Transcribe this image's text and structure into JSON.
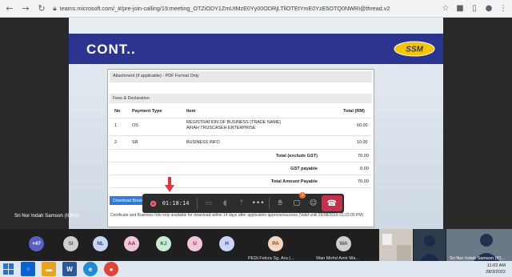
{
  "browser": {
    "back_icon": "back-arrow-icon",
    "forward_icon": "forward-arrow-icon",
    "reload_icon": "reload-icon",
    "url": "teams.microsoft.com/_#/pre-join-calling/19:meeting_OTZiODY1ZmUtMzE0Yy00ODRjLTllOTEtYmE0YzE5OTQ0NWRI@thread.v2"
  },
  "slide": {
    "title": "CONT..",
    "logo_text": "SSM"
  },
  "document": {
    "attachment_header": "Attachment (if applicable) - PDF Format Only",
    "fees_header": "Fees & Declaration",
    "columns": [
      "No",
      "Payment Type",
      "Item",
      "Total (RM)"
    ],
    "rows": [
      {
        "no": "1",
        "type": "OS",
        "item_line1": "REGISTRATION OF BUSINESS (TRADE NAME)",
        "item_line2": "AFIAH TRUSCASEH ENTERPRISE",
        "total": "60.00"
      },
      {
        "no": "2",
        "type": "SR",
        "item_line1": "BUSINESS INFO",
        "item_line2": "",
        "total": "10.00"
      }
    ],
    "total_exclude_gst_label": "Total (exclude GST)",
    "total_exclude_gst_value": "70.00",
    "gst_label": "GST payable",
    "gst_value": "0.00",
    "total_payable_label": "Total Amount Payable",
    "total_payable_value": "70.00",
    "download_button": "Download Borang A",
    "note": "Certificate and Business Info only available for download within 14 days after application approve/success (Valid until 29/08/2018 01:23:05 PM)"
  },
  "meeting": {
    "presenter_label": "Sri Nor Indah Samson (IOHO",
    "recording_time": "01:18:14",
    "chat_badge": "1"
  },
  "participants": {
    "more_count": "+47",
    "avatars": [
      "SI",
      "NL",
      "AA",
      "KJ",
      "U",
      "H"
    ],
    "tile1_initials": "PA",
    "tile1_name": "PEDi Felcra Sg. Ara (...",
    "tile2_initials": "WA",
    "tile2_name": "Wan Mohd Amir Wa...",
    "tile3_name": "Sri Nor Indah Samson (IO..."
  },
  "taskbar": {
    "time": "11:02 AM",
    "date": "28/3/2022"
  }
}
